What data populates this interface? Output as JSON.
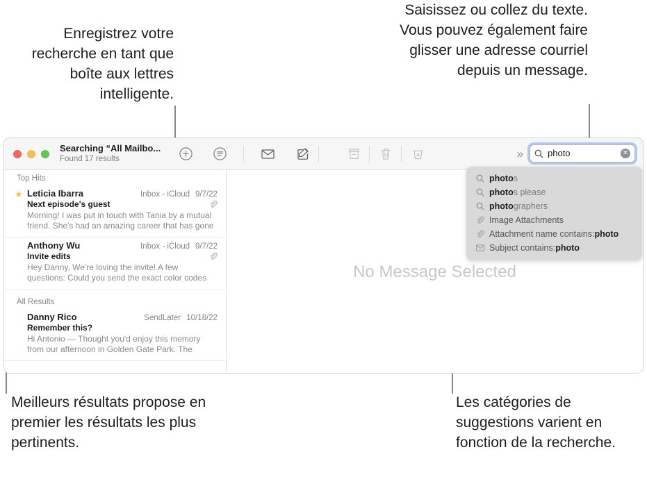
{
  "callouts": {
    "save_search": "Enregistrez votre recherche en tant que boîte aux lettres intelligente.",
    "type_paste": "Saisissez ou collez du texte. Vous pouvez également faire glisser une adresse courriel depuis un message.",
    "top_hits": "Meilleurs résultats propose en premier les résultats les plus pertinents.",
    "categories": "Les catégories de suggestions varient en fonction de la recherche."
  },
  "window": {
    "title": "Searching “All Mailbo...",
    "subtitle": "Found 17 results",
    "traffic_lights": {
      "close": "close-button",
      "minimize": "minimize-button",
      "zoom": "zoom-button"
    },
    "toolbar": {
      "add_label": "+",
      "add_name": "add-smart-mailbox",
      "filter_name": "filter-icon",
      "unread_name": "mark-unread-icon",
      "compose_name": "compose-icon",
      "archive_name": "archive-icon",
      "delete_name": "trash-icon",
      "junk_name": "junk-icon",
      "overflow_label": "»"
    },
    "search": {
      "value": "photo",
      "placeholder": "Search",
      "clear_label": "✕"
    }
  },
  "message_list": {
    "sections": [
      {
        "header": "Top Hits",
        "messages": [
          {
            "starred": true,
            "star_glyph": "★",
            "sender": "Leticia Ibarra",
            "mailbox": "Inbox - iCloud",
            "date": "9/7/22",
            "subject": "Next episode's guest",
            "has_attachment": true,
            "preview": "Morning! I was put in touch with Tania by a mutual friend. She's had an amazing career that has gone do…"
          },
          {
            "starred": false,
            "star_glyph": "",
            "sender": "Anthony Wu",
            "mailbox": "Inbox - iCloud",
            "date": "9/7/22",
            "subject": "Invite edits",
            "has_attachment": true,
            "preview": "Hey Danny, We're loving the invite! A few questions: Could you send the exact color codes you're proposin…"
          }
        ]
      },
      {
        "header": "All Results",
        "messages": [
          {
            "starred": false,
            "star_glyph": "",
            "sender": "Danny Rico",
            "mailbox": "SendLater",
            "date": "10/18/22",
            "subject": "Remember this?",
            "has_attachment": false,
            "preview": "Hi Antonio — Thought you'd enjoy this memory from our afternoon in Golden Gate Park. The flowers were…"
          }
        ]
      }
    ]
  },
  "detail_pane": {
    "empty_state": "No Message Selected"
  },
  "suggestions": [
    {
      "icon": "search-icon",
      "matched": "photo",
      "rest": "s",
      "label": ""
    },
    {
      "icon": "search-icon",
      "matched": "photo",
      "rest": "s please",
      "label": ""
    },
    {
      "icon": "search-icon",
      "matched": "photo",
      "rest": "graphers",
      "label": ""
    },
    {
      "icon": "paperclip-icon",
      "matched": "",
      "rest": "",
      "label": "Image Attachments"
    },
    {
      "icon": "paperclip-icon",
      "matched": "photo",
      "rest": "",
      "label": "Attachment name contains: "
    },
    {
      "icon": "envelope-icon",
      "matched": "photo",
      "rest": "",
      "label": "Subject contains: "
    }
  ],
  "colors": {
    "accent_focus": "#6496f0",
    "star": "#f6c544",
    "traffic_red": "#f4645c",
    "traffic_yellow": "#f5be50",
    "traffic_green": "#61c554",
    "popover_bg": "#d9d9d9"
  }
}
